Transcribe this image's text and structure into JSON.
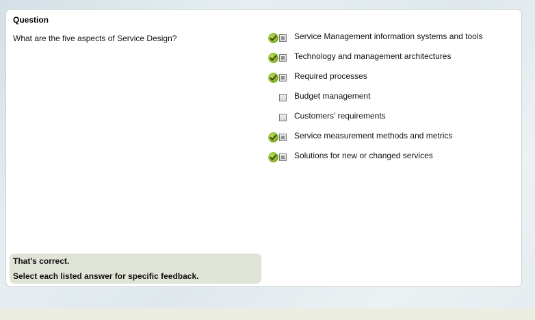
{
  "panel": {
    "title": "Question"
  },
  "question": {
    "text": "What are the five aspects of Service Design?"
  },
  "answers": [
    {
      "label": "Service Management information systems and tools",
      "correct": true,
      "checked": true
    },
    {
      "label": "Technology and management architectures",
      "correct": true,
      "checked": true
    },
    {
      "label": "Required processes",
      "correct": true,
      "checked": true
    },
    {
      "label": "Budget management",
      "correct": false,
      "checked": false
    },
    {
      "label": "Customers' requirements",
      "correct": false,
      "checked": false
    },
    {
      "label": "Service measurement methods and metrics",
      "correct": true,
      "checked": true
    },
    {
      "label": "Solutions for new or changed services",
      "correct": true,
      "checked": true
    }
  ],
  "feedback": {
    "title": "That's correct.",
    "detail": "Select each listed answer for specific feedback."
  },
  "colors": {
    "correct_icon": "#8bb42c",
    "feedback_bg": "#e0e4d7"
  }
}
